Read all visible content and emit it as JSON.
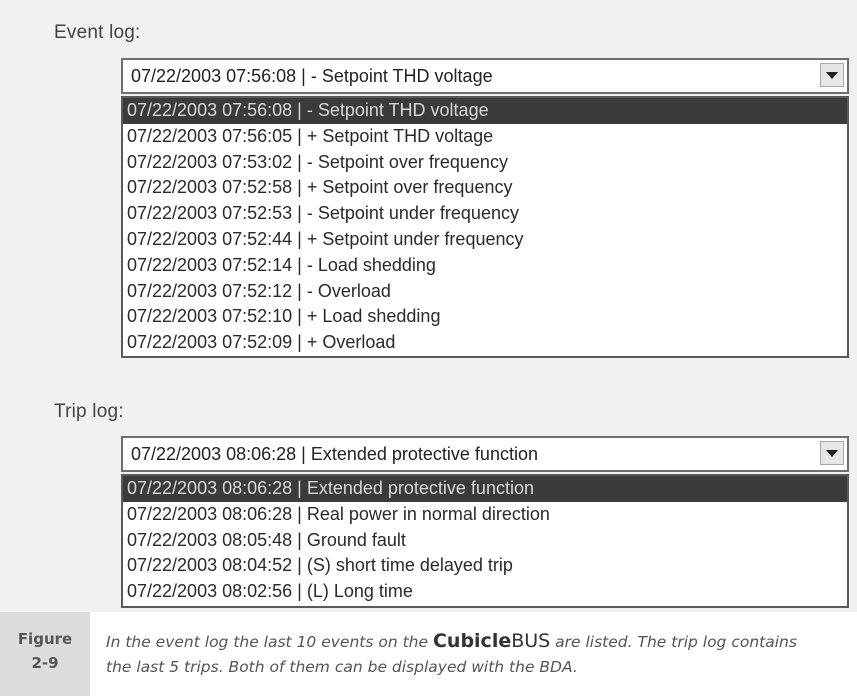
{
  "event_log": {
    "label": "Event log:",
    "combo_value": "07/22/2003  07:56:08 | - Setpoint THD voltage",
    "rows": [
      "07/22/2003  07:56:08 | - Setpoint THD voltage",
      "07/22/2003  07:56:05 | + Setpoint THD voltage",
      "07/22/2003  07:53:02 | - Setpoint over frequency",
      "07/22/2003  07:52:58 | + Setpoint over frequency",
      "07/22/2003  07:52:53 | - Setpoint under frequency",
      "07/22/2003  07:52:44 | + Setpoint under frequency",
      "07/22/2003  07:52:14 | - Load shedding",
      "07/22/2003  07:52:12 | - Overload",
      "07/22/2003  07:52:10 | + Load shedding",
      "07/22/2003  07:52:09 | + Overload"
    ],
    "selected_index": 0
  },
  "trip_log": {
    "label": "Trip log:",
    "combo_value": "07/22/2003  08:06:28 | Extended protective function",
    "rows": [
      "07/22/2003  08:06:28 | Extended protective function",
      "07/22/2003  08:06:28 | Real power in normal direction",
      "07/22/2003  08:05:48 | Ground fault",
      "07/22/2003  08:04:52 | (S) short time delayed trip",
      "07/22/2003  08:02:56 | (L) Long time"
    ],
    "selected_index": 0
  },
  "caption": {
    "figure_word": "Figure",
    "figure_number": "2-9",
    "text_before": "In the event log the last 10 events on the ",
    "brand_bold": "Cubicle",
    "brand_regular": "BUS",
    "text_after": " are listed. The trip log contains the last 5 trips. Both of them can be displayed with the BDA."
  },
  "icons": {
    "dropdown": "chevron-down-icon"
  },
  "colors": {
    "panel_bg": "#f2f1f1",
    "selection_bg": "#3b3b3b",
    "figure_box_bg": "#dcdcdc"
  }
}
